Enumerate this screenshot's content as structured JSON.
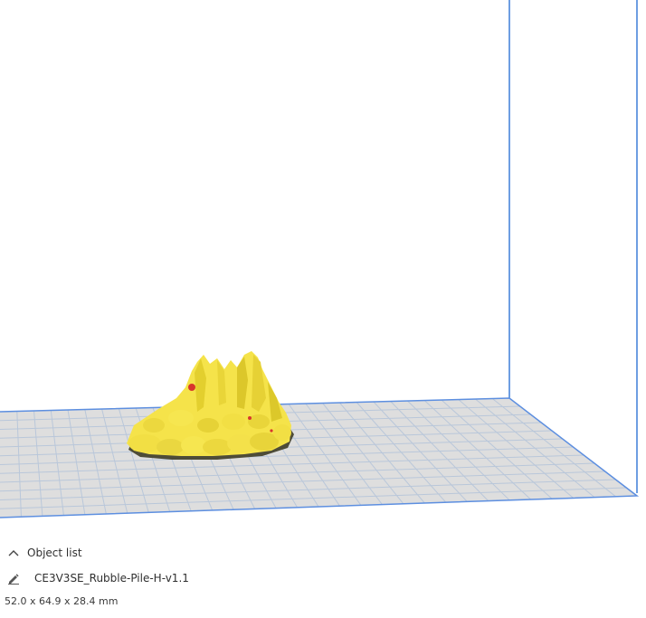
{
  "viewport": {
    "build_plate_color": "#dedede",
    "grid_line_color": "#b9c7da",
    "volume_edge_color": "#3f7fd8",
    "model_color": "#f5e34a",
    "model_shadow_color": "#55533e",
    "model_highlight_color": "#d8362c"
  },
  "object_list": {
    "collapse_icon": "chevron-up-icon",
    "title": "Object list",
    "edit_icon": "pencil-icon",
    "object_name": "CE3V3SE_Rubble-Pile-H-v1.1",
    "dimensions": "52.0 x 64.9 x 28.4 mm"
  }
}
